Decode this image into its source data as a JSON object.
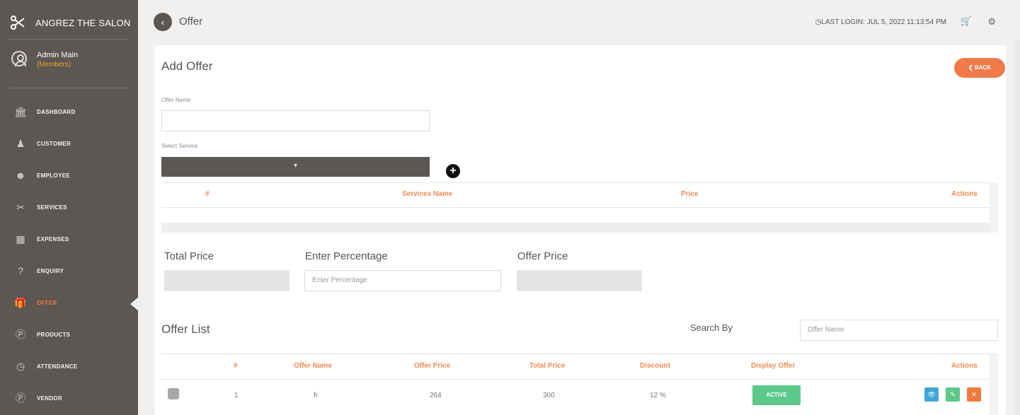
{
  "brand": {
    "title": "ANGREZ THE SALON"
  },
  "user": {
    "name": "Admin Main",
    "role": "(Members)"
  },
  "nav": [
    {
      "label": "DASHBOARD",
      "icon": "bank-icon"
    },
    {
      "label": "CUSTOMER",
      "icon": "person-icon"
    },
    {
      "label": "EMPLOYEE",
      "icon": "group-icon"
    },
    {
      "label": "SERVICES",
      "icon": "scissors-icon"
    },
    {
      "label": "EXPENSES",
      "icon": "calculator-icon"
    },
    {
      "label": "ENQUIRY",
      "icon": "question-icon"
    },
    {
      "label": "OFFER",
      "icon": "gift-icon",
      "active": true
    },
    {
      "label": "PRODUCTS",
      "icon": "product-icon"
    },
    {
      "label": "ATTENDANCE",
      "icon": "clock-icon"
    },
    {
      "label": "VENDOR",
      "icon": "vendor-icon"
    }
  ],
  "topbar": {
    "title": "Offer",
    "last_login": "LAST LOGIN: JUL 5, 2022 11:13:54 PM"
  },
  "form": {
    "heading": "Add Offer",
    "back_label": "BACK",
    "offer_name_label": "Offer Name",
    "offer_name_value": "",
    "select_service_label": "Select Service",
    "services_columns": [
      "#",
      "Services Name",
      "Price",
      "Actions"
    ],
    "total_price_label": "Total Price",
    "percentage_label": "Enter Percentage",
    "percentage_placeholder": "Enter Percentage",
    "offer_price_label": "Offer Price"
  },
  "list": {
    "heading": "Offer List",
    "search_label": "Search By",
    "search_placeholder": "Offer Name",
    "columns": [
      "#",
      "Offer Name",
      "Offer Price",
      "Total Price",
      "Discount",
      "Display Offer",
      "Actions"
    ],
    "rows": [
      {
        "num": "1",
        "name": "fr",
        "offer_price": "264",
        "total_price": "300",
        "discount": "12 %",
        "status": "ACTIVE"
      }
    ]
  },
  "colors": {
    "sidebar": "#5c5752",
    "accent": "#f07a3e",
    "active": "#5cc98b",
    "view": "#3ea7d8",
    "edit": "#5cc98b",
    "delete": "#f07a3e"
  }
}
